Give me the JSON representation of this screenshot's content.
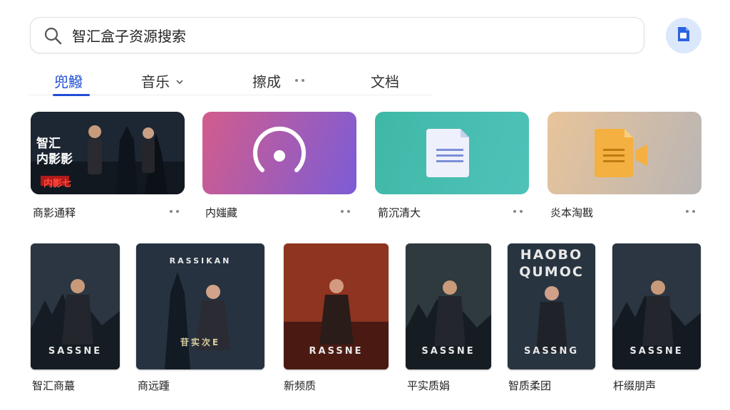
{
  "search": {
    "value": "智汇盒子资源搜索"
  },
  "tabs": [
    {
      "label": "兜鱍"
    },
    {
      "label": "音乐"
    },
    {
      "label": "擦成"
    },
    {
      "label": "文档"
    }
  ],
  "cards": [
    {
      "label": "商影通释",
      "poster_text": "智汇\n内影影",
      "poster_red": "内影七"
    },
    {
      "label": "内媸藏"
    },
    {
      "label": "箭沉清大"
    },
    {
      "label": "炎本淘戡"
    }
  ],
  "posters": [
    {
      "label": "智汇商蕞",
      "title_top": "",
      "title_bottom": "SASSNE"
    },
    {
      "label": "商远踵",
      "title_top": "RASSIKAN",
      "title_bottom": "苷实次E"
    },
    {
      "label": "新频质",
      "title_top": "",
      "title_bottom": "RASSNE"
    },
    {
      "label": "平实质娟",
      "title_top": "",
      "title_bottom": "SASSNE"
    },
    {
      "label": "智质柔团",
      "title_top": "HAOBO QUMOC",
      "title_bottom": "SASSNG"
    },
    {
      "label": "杆缀朋声",
      "title_top": "",
      "title_bottom": "SASSNE"
    }
  ],
  "colors": {
    "accent": "#1f4fd6",
    "card_music_from": "#d35c8c",
    "card_music_to": "#7c5cd6",
    "card_doc_from": "#3fb8a7",
    "card_doc_to": "#4fc2b8",
    "card_video_from": "#e7c7a0",
    "card_video_to": "#c7b8a8"
  }
}
